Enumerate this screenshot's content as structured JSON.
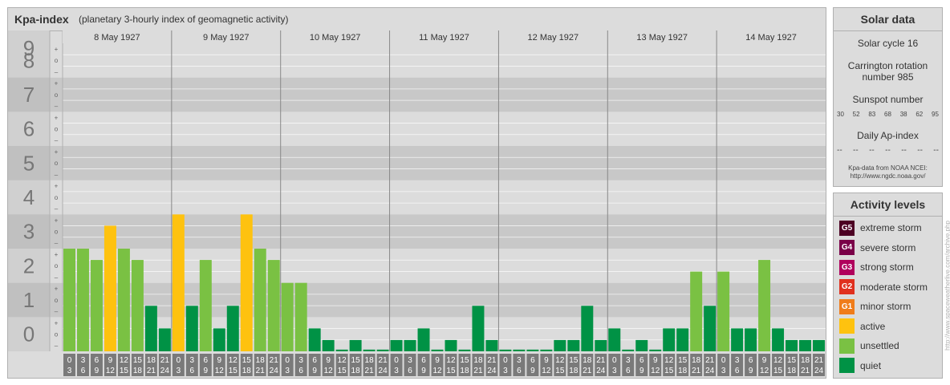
{
  "header": {
    "title": "Kpa-index",
    "subtitle": "(planetary 3-hourly index of geomagnetic activity)"
  },
  "chart_data": {
    "type": "bar",
    "ylim": [
      0,
      9
    ],
    "y_ticks": [
      "0",
      "1",
      "2",
      "3",
      "4",
      "5",
      "6",
      "7",
      "8",
      "9"
    ],
    "minor_marks": [
      "–",
      "o",
      "+"
    ],
    "days": [
      "8 May 1927",
      "9 May 1927",
      "10 May 1927",
      "11 May 1927",
      "12 May 1927",
      "13 May 1927",
      "14 May 1927"
    ],
    "interval_labels": [
      [
        "0",
        "3"
      ],
      [
        "3",
        "6"
      ],
      [
        "6",
        "9"
      ],
      [
        "9",
        "12"
      ],
      [
        "12",
        "15"
      ],
      [
        "15",
        "18"
      ],
      [
        "18",
        "21"
      ],
      [
        "21",
        "24"
      ]
    ],
    "values": [
      3.0,
      3.0,
      2.67,
      3.67,
      3.0,
      2.67,
      1.33,
      0.67,
      4.0,
      1.33,
      2.67,
      0.67,
      1.33,
      4.0,
      3.0,
      2.67,
      2.0,
      2.0,
      0.67,
      0.33,
      0.0,
      0.33,
      0.0,
      0.0,
      0.33,
      0.33,
      0.67,
      0.0,
      0.33,
      0.0,
      1.33,
      0.33,
      0.0,
      0.0,
      0.0,
      0.0,
      0.33,
      0.33,
      1.33,
      0.33,
      0.67,
      0.0,
      0.33,
      0.0,
      0.67,
      0.67,
      2.33,
      1.33,
      2.33,
      0.67,
      0.67,
      2.67,
      0.67,
      0.33,
      0.33,
      0.33
    ],
    "colors": {
      "quiet": "#009245",
      "unsettled": "#7ac143",
      "active": "#fec20f"
    },
    "grid": true
  },
  "solar": {
    "title": "Solar data",
    "cycle": "Solar cycle 16",
    "carrington_1": "Carrington rotation",
    "carrington_2": "number 985",
    "sunspot_label": "Sunspot number",
    "sunspot_values": [
      "30",
      "52",
      "83",
      "68",
      "38",
      "62",
      "95"
    ],
    "ap_label": "Daily Ap-index",
    "ap_values": [
      "--",
      "--",
      "--",
      "--",
      "--",
      "--",
      "--"
    ],
    "credit_1": "Kpa-data from NOAA NCEI:",
    "credit_2": "http://www.ngdc.noaa.gov/"
  },
  "activity": {
    "title": "Activity levels",
    "items": [
      {
        "badge": "G5",
        "label": "extreme storm",
        "color": "#4d0023"
      },
      {
        "badge": "G4",
        "label": "severe storm",
        "color": "#7a0048"
      },
      {
        "badge": "G3",
        "label": "strong storm",
        "color": "#b0005c"
      },
      {
        "badge": "G2",
        "label": "moderate storm",
        "color": "#e0301e"
      },
      {
        "badge": "G1",
        "label": "minor storm",
        "color": "#f07c1a"
      },
      {
        "badge": "",
        "label": "active",
        "color": "#fec20f"
      },
      {
        "badge": "",
        "label": "unsettled",
        "color": "#7ac143"
      },
      {
        "badge": "",
        "label": "quiet",
        "color": "#009245"
      }
    ]
  },
  "watermark": "http://www.spaceweatherlive.com/archive.php"
}
